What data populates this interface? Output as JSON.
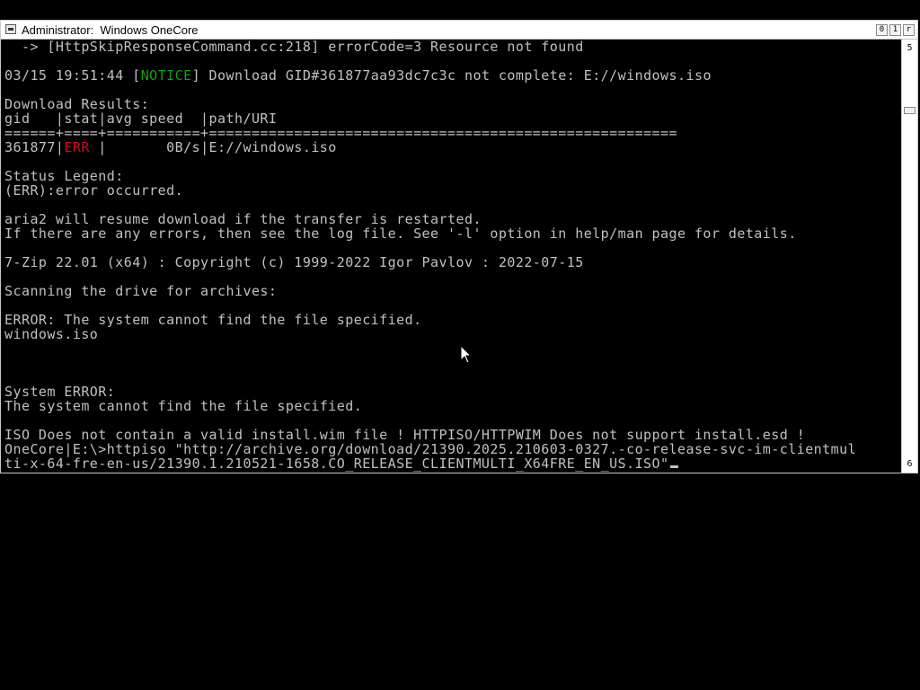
{
  "window": {
    "title": "Administrator:  Windows OneCore",
    "buttons": [
      "0",
      "1",
      "r"
    ]
  },
  "scrollbar": {
    "up_label": "5",
    "down_label": "6"
  },
  "console": {
    "lines": [
      "  -> [HttpSkipResponseCommand.cc:218] errorCode=3 Resource not found",
      "",
      "03/15 19:51:44 [",
      "",
      "Download Results:",
      "gid   |stat|avg speed  |path/URI",
      "======+====+===========+=======================================================",
      "361877|",
      "",
      "Status Legend:",
      "(ERR):error occurred.",
      "",
      "aria2 will resume download if the transfer is restarted.",
      "If there are any errors, then see the log file. See '-l' option in help/man page for details.",
      "",
      "7-Zip 22.01 (x64) : Copyright (c) 1999-2022 Igor Pavlov : 2022-07-15",
      "",
      "Scanning the drive for archives:",
      "",
      "ERROR: The system cannot find the file specified.",
      "windows.iso",
      "",
      "",
      "",
      "System ERROR:",
      "The system cannot find the file specified.",
      "",
      "ISO Does not contain a valid install.wim file ! HTTPISO/HTTPWIM Does not support install.esd !",
      "OneCore|E:\\>httpiso \"http://archive.org/download/21390.2025.210603-0327.-co-release-svc-im-clientmul",
      "ti-x-64-fre-en-us/21390.1.210521-1658.CO_RELEASE_CLIENTMULTI_X64FRE_EN_US.ISO\""
    ],
    "notice_tag": "NOTICE",
    "notice_rest": "] Download GID#361877aa93dc7c3c not complete: E://windows.iso",
    "err_tag": "ERR",
    "err_rest": " |       0B/s|E://windows.iso"
  },
  "colors": {
    "text": "#c0c0c0",
    "notice": "#13a10e",
    "error": "#c50f1f",
    "background": "#000000"
  }
}
